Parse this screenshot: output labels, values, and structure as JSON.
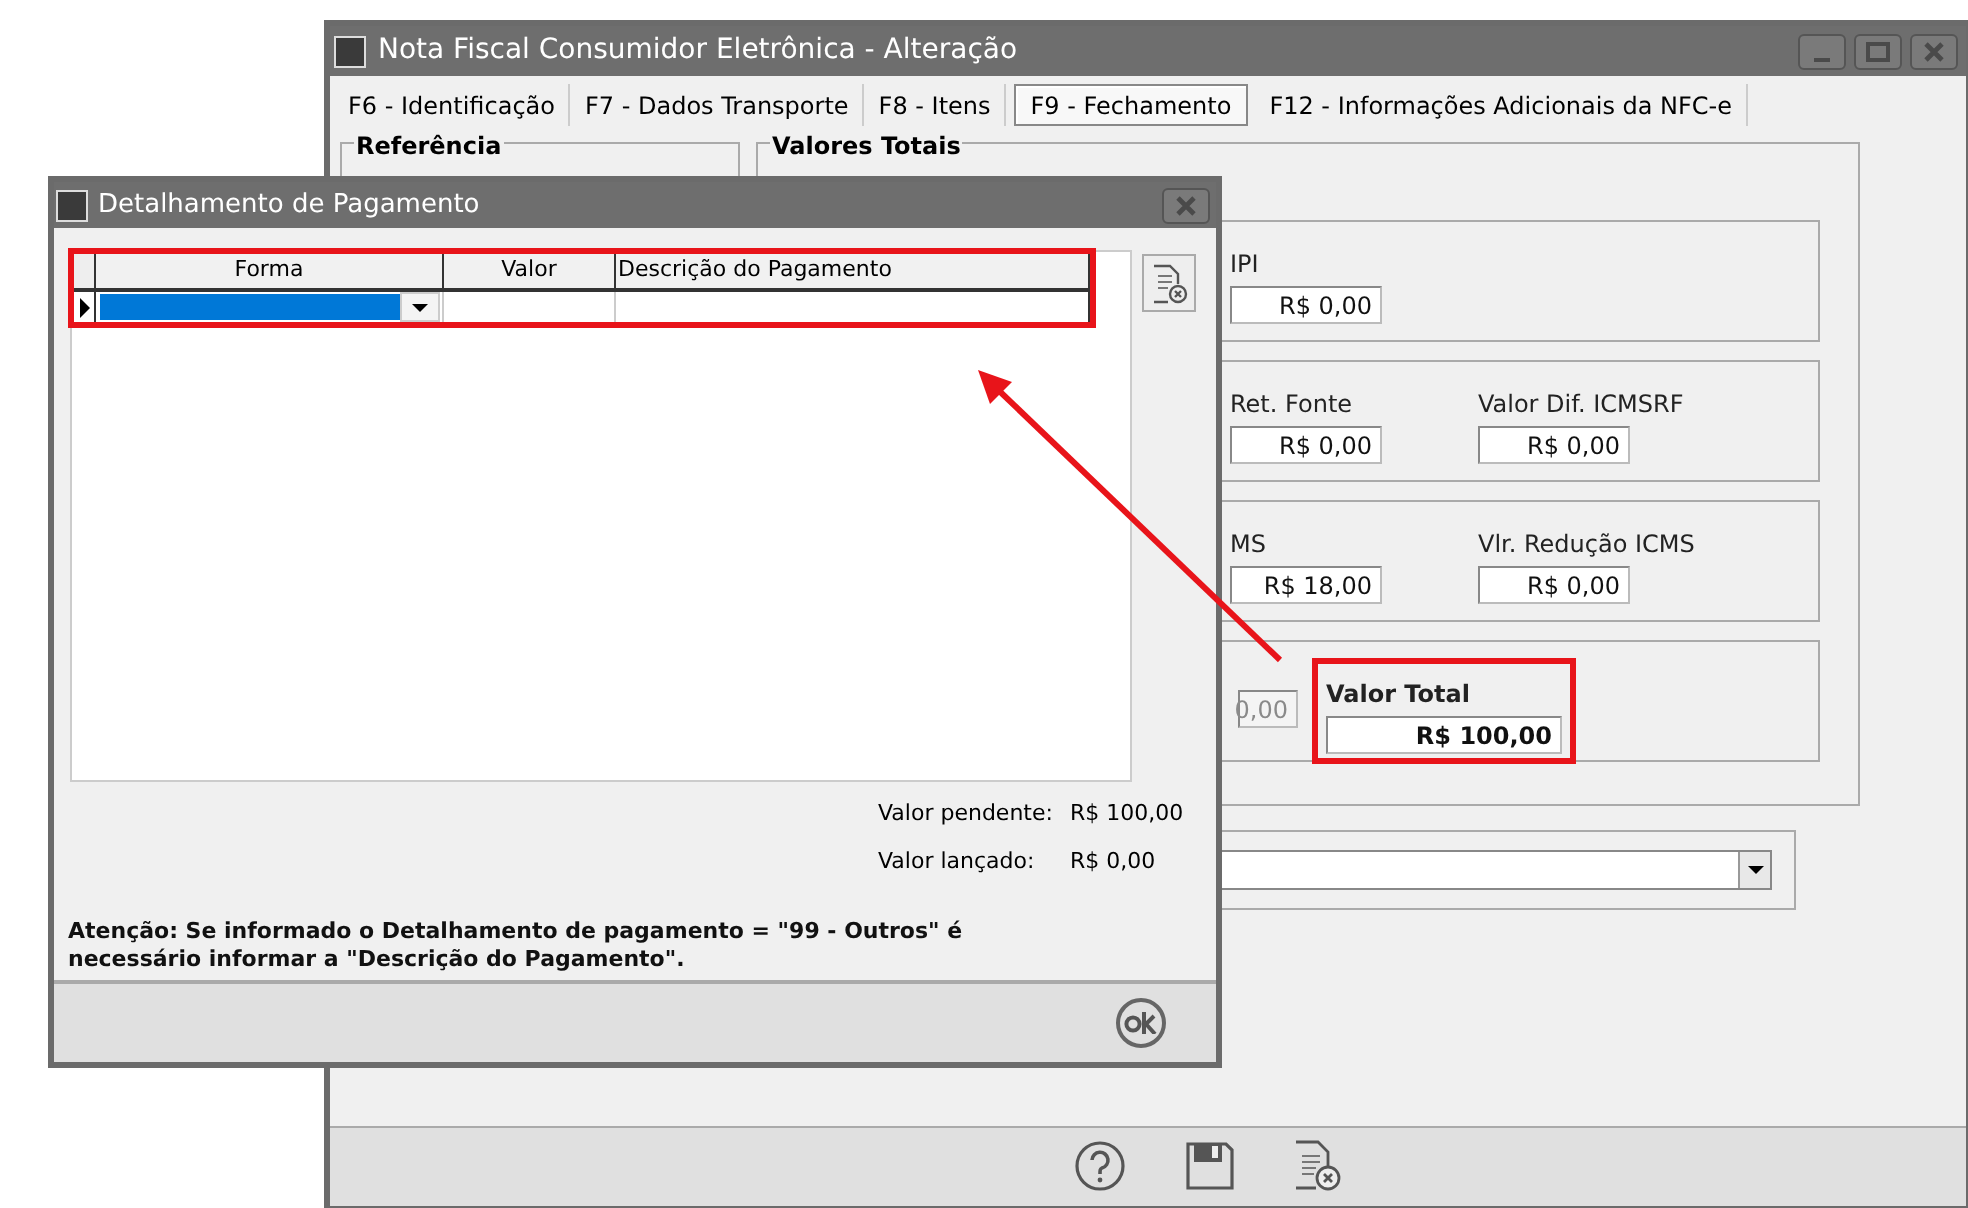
{
  "main_window": {
    "title": "Nota Fiscal Consumidor Eletrônica - Alteração"
  },
  "tabs": [
    {
      "label": "F6 - Identificação",
      "selected": false
    },
    {
      "label": "F7 - Dados Transporte",
      "selected": false
    },
    {
      "label": "F8 - Itens",
      "selected": false
    },
    {
      "label": "F9 - Fechamento",
      "selected": true
    },
    {
      "label": "F12 - Informações Adicionais da NFC-e",
      "selected": false
    }
  ],
  "referencia": {
    "title": "Referência"
  },
  "valores_totais": {
    "title": "Valores Totais",
    "boxes": [
      {
        "fields": [
          {
            "label": "IPI",
            "value": "R$ 0,00",
            "disabled": false,
            "highlighted": false
          }
        ]
      },
      {
        "fields": [
          {
            "label": "Ret. Fonte",
            "value": "R$ 0,00",
            "disabled": false,
            "highlighted": false
          },
          {
            "label": "Valor Dif. ICMSRF",
            "value": "R$ 0,00",
            "disabled": false,
            "highlighted": false
          }
        ]
      },
      {
        "fields": [
          {
            "label": "MS",
            "value": "R$ 18,00",
            "disabled": false,
            "highlighted": false
          },
          {
            "label": "Vlr. Redução ICMS",
            "value": "R$ 0,00",
            "disabled": false,
            "highlighted": false
          }
        ]
      },
      {
        "fields": [
          {
            "value": "0,00",
            "disabled": true,
            "highlighted": false
          },
          {
            "label": "Valor Total",
            "value": "R$ 100,00",
            "disabled": false,
            "highlighted": true
          }
        ]
      }
    ]
  },
  "dialog": {
    "title": "Detalhamento de Pagamento",
    "grid": {
      "columns": [
        "Forma",
        "Valor",
        "Descrição do Pagamento"
      ],
      "rows": [
        {
          "selected": true
        }
      ]
    },
    "summary": [
      {
        "label": "Valor pendente:",
        "value": "R$ 100,00"
      },
      {
        "label": "Valor lançado:",
        "value": "R$ 0,00"
      }
    ],
    "warning": "Atenção: Se informado o Detalhamento de pagamento = \"99 - Outros\" é necessário informar a \"Descrição do Pagamento\"."
  }
}
